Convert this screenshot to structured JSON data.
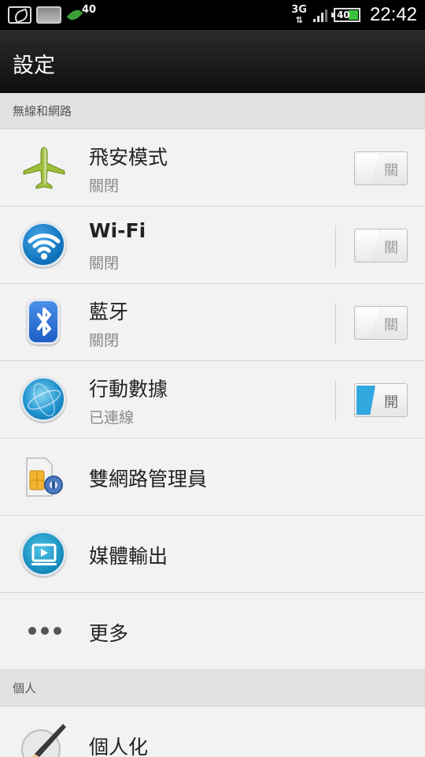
{
  "status_bar": {
    "notification_count": "40",
    "network_type": "3G",
    "battery_level": "40",
    "time": "22:42"
  },
  "header": {
    "title": "設定"
  },
  "sections": {
    "wireless": "無線和網路",
    "personal": "個人"
  },
  "rows": {
    "airplane": {
      "label": "飛安模式",
      "status": "關閉",
      "toggle": "關"
    },
    "wifi": {
      "label": "Wi-Fi",
      "status": "關閉",
      "toggle": "關"
    },
    "bluetooth": {
      "label": "藍牙",
      "status": "關閉",
      "toggle": "關"
    },
    "mobile_data": {
      "label": "行動數據",
      "status": "已連線",
      "toggle": "開"
    },
    "dual_network": {
      "label": "雙網路管理員"
    },
    "media_output": {
      "label": "媒體輸出"
    },
    "more": {
      "label": "更多"
    },
    "personalize": {
      "label": "個人化"
    }
  },
  "colors": {
    "toggle_on": "#31a8e0",
    "header_bg": "#1a1a1a"
  }
}
